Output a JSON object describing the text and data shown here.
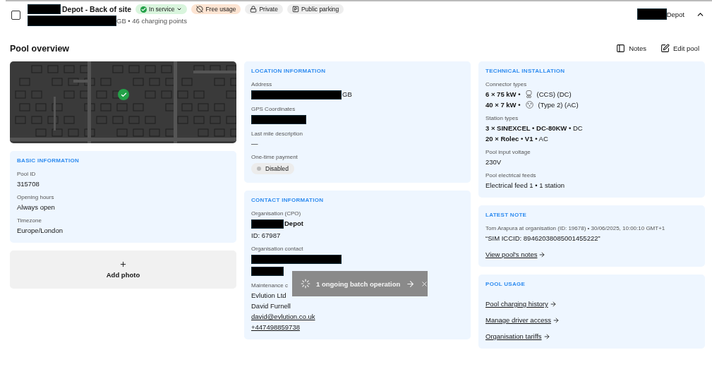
{
  "header": {
    "checked": false,
    "title": "Depot - Back of site",
    "subtitle": "GB • 46 charging points",
    "organisation": "Depot",
    "expanded": true,
    "tags": [
      {
        "kind": "status",
        "label": "In service"
      },
      {
        "kind": "free",
        "label": "Free usage"
      },
      {
        "kind": "private",
        "label": "Private"
      },
      {
        "kind": "parking",
        "label": "Public parking"
      }
    ]
  },
  "page_title": "Pool overview",
  "actions": [
    {
      "kind": "notes",
      "label": "Notes"
    },
    {
      "kind": "edit",
      "label": "Edit pool"
    }
  ],
  "columns": [
    [
      {
        "kind": "map"
      },
      {
        "kind": "card",
        "title": "BASIC INFORMATION",
        "fields": [
          {
            "label": "Pool ID",
            "lines": [
              {
                "kind": "text",
                "text": "315708"
              }
            ]
          },
          {
            "label": "Opening hours",
            "lines": [
              {
                "kind": "text",
                "text": "Always open"
              }
            ]
          },
          {
            "label": "Timezone",
            "lines": [
              {
                "kind": "text",
                "text": "Europe/London"
              }
            ]
          }
        ]
      },
      {
        "label": "Add photo"
      }
    ],
    [
      {
        "kind": "card",
        "title": "LOCATION INFORMATION",
        "fields": [
          {
            "label": "Address",
            "lines": [
              {
                "kind": "redacted",
                "text": "GB"
              }
            ]
          },
          {
            "label": "GPS Coordinates",
            "lines": [
              {
                "kind": "redacted"
              }
            ]
          },
          {
            "label": "Last mile description",
            "lines": [
              {
                "kind": "text",
                "text": "—"
              }
            ]
          },
          {
            "label": "One-time payment",
            "lines": [
              {
                "kind": "pill",
                "text": "Disabled",
                "on": false
              }
            ]
          }
        ]
      },
      {
        "kind": "card",
        "title": "CONTACT INFORMATION",
        "fields": [
          {
            "label": "Organisation (CPO)",
            "lines": [
              {
                "kind": "redacted",
                "text": "Depot",
                "bold": true
              },
              {
                "kind": "text",
                "text": "ID: 67987"
              }
            ]
          },
          {
            "label": "Organisation contact",
            "lines": [
              {
                "kind": "redacted"
              },
              {
                "kind": "redacted"
              }
            ]
          },
          {
            "label": "Maintenance c",
            "lines": [
              {
                "kind": "text",
                "text": "Evlution Ltd"
              },
              {
                "kind": "text",
                "text": "David Furnell"
              },
              {
                "kind": "link",
                "text": "david@evlution.co.uk"
              },
              {
                "kind": "link",
                "text": "+447498859738"
              }
            ]
          }
        ]
      }
    ],
    [
      {
        "kind": "card",
        "title": "TECHNICAL INSTALLATION",
        "fields": [
          {
            "label": "Connector types",
            "lines": [
              {
                "kind": "connector",
                "text": "6 × 75 kW •",
                "detail": "(CCS) (DC)"
              },
              {
                "kind": "connector",
                "text": "40 × 7 kW •",
                "detail": "(Type 2) (AC)"
              }
            ]
          },
          {
            "label": "Station types",
            "lines": [
              {
                "kind": "rich",
                "text": "**3 × SINEXCEL • DC-80KW •** DC"
              },
              {
                "kind": "rich",
                "text": "**20 × Rolec • V1 •** AC"
              }
            ]
          },
          {
            "label": "Pool input voltage",
            "lines": [
              {
                "kind": "text",
                "text": "230V"
              }
            ]
          },
          {
            "label": "Pool electrical feeds",
            "lines": [
              {
                "kind": "text",
                "text": "Electrical feed 1 • 1 station"
              }
            ]
          }
        ]
      },
      {
        "kind": "card",
        "title": "LATEST NOTE",
        "fields": [
          {
            "label": "Tom Arapura at organisation (ID: 19678) • 30/06/2025, 10:00:10 GMT+1",
            "lines": [
              {
                "kind": "text",
                "text": "“SIM ICCID: 89462038085001455222”"
              },
              {
                "kind": "arrowlink",
                "text": "View pool's notes"
              }
            ]
          }
        ]
      },
      {
        "kind": "card",
        "title": "POOL USAGE",
        "fields": [
          {
            "lines": [
              {
                "kind": "arrowlink",
                "text": "Pool charging history"
              },
              {
                "kind": "arrowlink",
                "text": "Manage driver access"
              },
              {
                "kind": "arrowlink",
                "text": "Organisation tariffs"
              }
            ]
          }
        ]
      }
    ]
  ],
  "toast": {
    "label": "1 ongoing batch operation"
  }
}
